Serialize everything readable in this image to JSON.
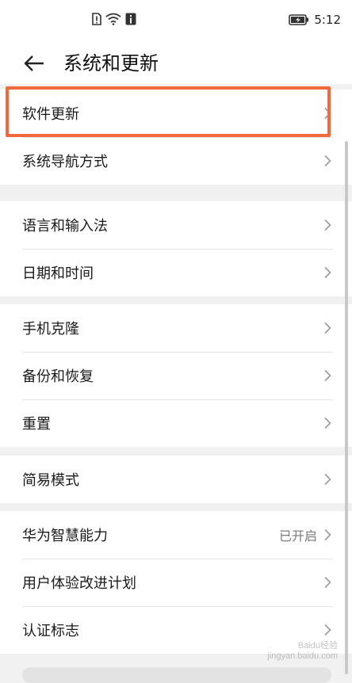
{
  "status_bar": {
    "time": "5:12",
    "icons": [
      "sim-alert-icon",
      "wifi-icon",
      "notification-icon",
      "battery-icon"
    ]
  },
  "title_bar": {
    "back_icon": "back-arrow-icon",
    "title": "系统和更新"
  },
  "groups": [
    {
      "items": [
        {
          "label": "软件更新"
        },
        {
          "label": "系统导航方式"
        }
      ]
    },
    {
      "items": [
        {
          "label": "语言和输入法"
        },
        {
          "label": "日期和时间"
        }
      ]
    },
    {
      "items": [
        {
          "label": "手机克隆"
        },
        {
          "label": "备份和恢复"
        },
        {
          "label": "重置"
        }
      ]
    },
    {
      "items": [
        {
          "label": "简易模式"
        }
      ]
    },
    {
      "items": [
        {
          "label": "华为智慧能力",
          "value": "已开启"
        },
        {
          "label": "用户体验改进计划"
        },
        {
          "label": "认证标志"
        }
      ]
    }
  ],
  "highlight_color": "#f26a3c",
  "watermark": {
    "line1": "Baidu经验",
    "line2": "jingyan.baidu.com"
  }
}
